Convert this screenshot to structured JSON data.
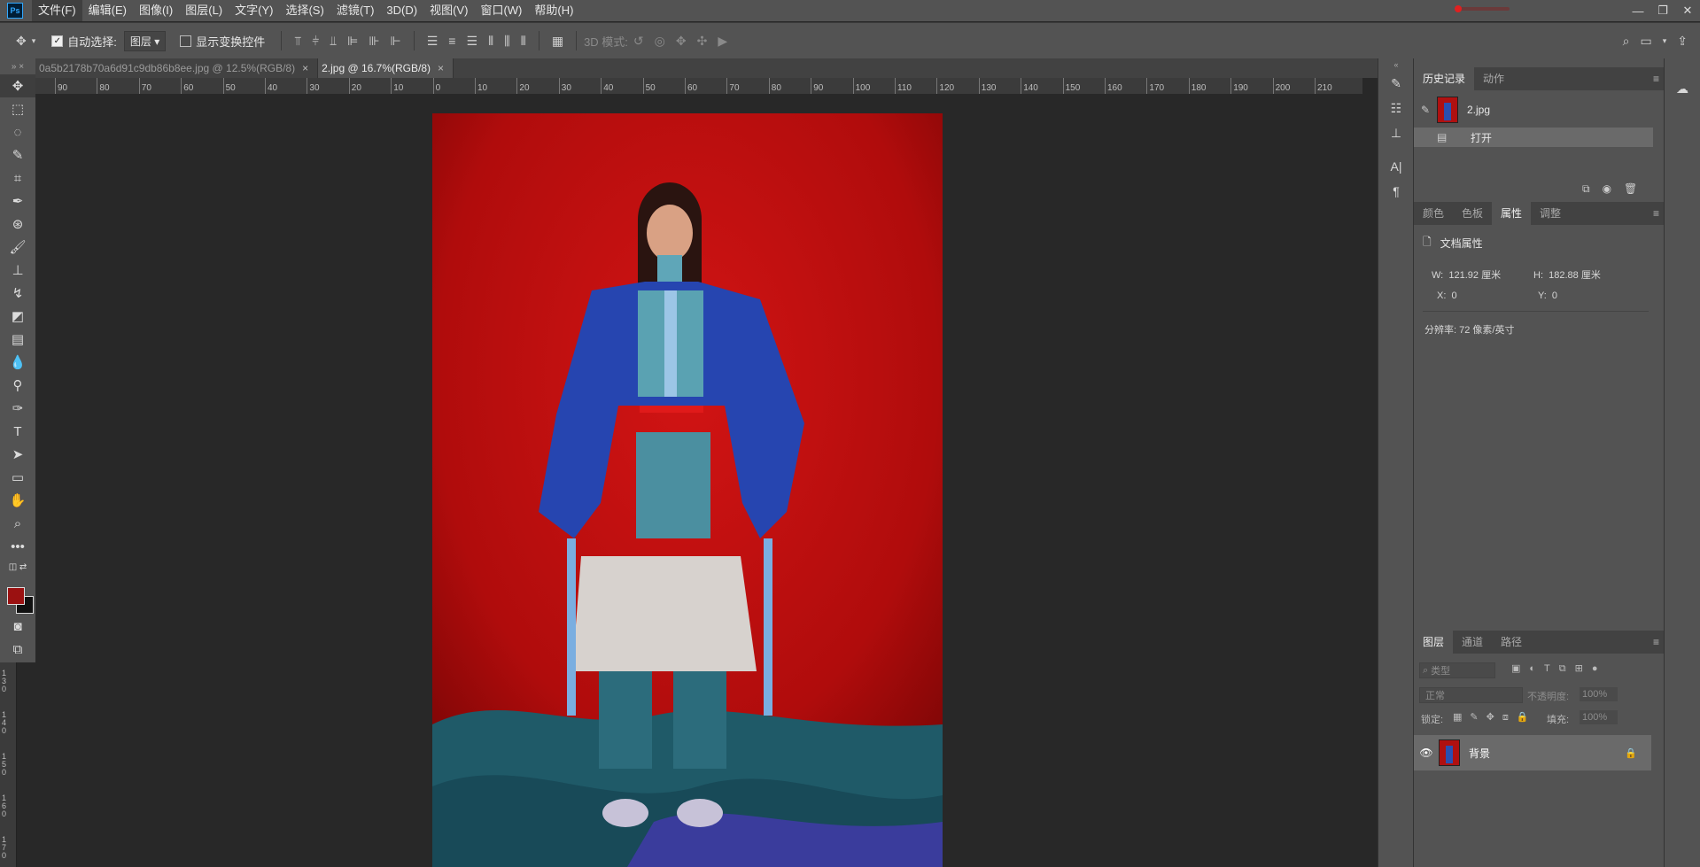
{
  "app": {
    "logo": "Ps"
  },
  "menu": [
    "文件(F)",
    "编辑(E)",
    "图像(I)",
    "图层(L)",
    "文字(Y)",
    "选择(S)",
    "滤镜(T)",
    "3D(D)",
    "视图(V)",
    "窗口(W)",
    "帮助(H)"
  ],
  "window_controls": {
    "minimize": "—",
    "restore": "❐",
    "close": "✕"
  },
  "options": {
    "auto_select_label": "自动选择:",
    "auto_select_value": "图层",
    "show_transform_label": "显示变换控件",
    "mode_3d_label": "3D 模式:"
  },
  "tabs": [
    {
      "label": "0a5b2178b70a6d91c9db86b8ee.jpg @ 12.5%(RGB/8)",
      "close": "×",
      "active": false
    },
    {
      "label": "2.jpg @ 16.7%(RGB/8)",
      "close": "×",
      "active": true
    }
  ],
  "hruler": [
    "90",
    "80",
    "70",
    "60",
    "50",
    "40",
    "30",
    "20",
    "10",
    "0",
    "10",
    "20",
    "30",
    "40",
    "50",
    "60",
    "70",
    "80",
    "90",
    "100",
    "110",
    "120",
    "130",
    "140",
    "150",
    "160",
    "170",
    "180",
    "190",
    "200",
    "210"
  ],
  "vruler": [
    "130",
    "140",
    "150",
    "160",
    "170"
  ],
  "history_panel": {
    "tabs": [
      "历史记录",
      "动作"
    ],
    "snapshot": "2.jpg",
    "steps": [
      "打开"
    ]
  },
  "properties_panel": {
    "tabs": [
      "颜色",
      "色板",
      "属性",
      "调整"
    ],
    "section_title": "文档属性",
    "w_label": "W:",
    "w_value": "121.92 厘米",
    "h_label": "H:",
    "h_value": "182.88 厘米",
    "x_label": "X:",
    "x_value": "0",
    "y_label": "Y:",
    "y_value": "0",
    "resolution": "分辨率: 72 像素/英寸"
  },
  "layers_panel": {
    "tabs": [
      "图层",
      "通道",
      "路径"
    ],
    "filter_placeholder": "类型",
    "blend_mode": "正常",
    "opacity_label": "不透明度:",
    "opacity_value": "100%",
    "lock_label": "锁定:",
    "fill_label": "填充:",
    "fill_value": "100%",
    "layers": [
      {
        "name": "背景",
        "visible": true,
        "locked": true
      }
    ]
  },
  "colors": {
    "foreground": "#9b1111",
    "background": "#111111"
  }
}
